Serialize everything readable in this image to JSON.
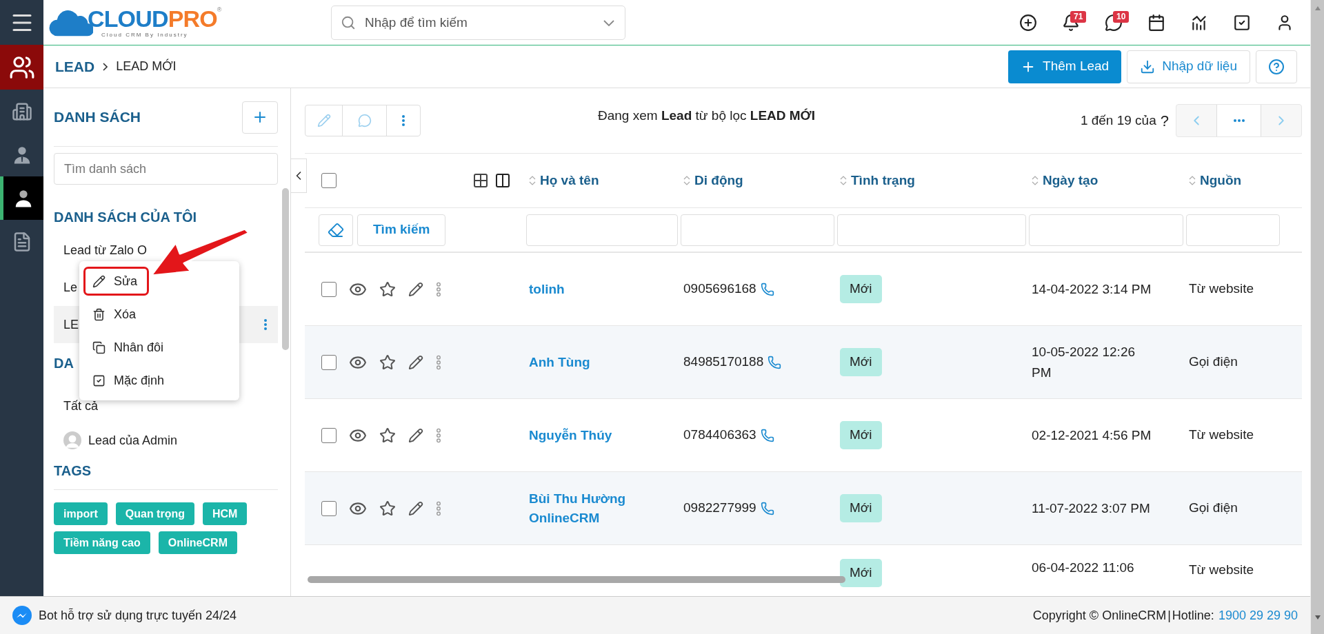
{
  "logo": {
    "text_1": "CLOUD",
    "text_2": "PRO",
    "mark": "®",
    "tagline": "Cloud CRM By Industry"
  },
  "search": {
    "placeholder": "Nhập để tìm kiếm"
  },
  "header_icons": [
    {
      "kind": "add"
    },
    {
      "kind": "bell",
      "badge": "71"
    },
    {
      "kind": "chat",
      "badge": "10"
    },
    {
      "kind": "calendar"
    },
    {
      "kind": "chart"
    },
    {
      "kind": "task"
    },
    {
      "kind": "user"
    }
  ],
  "rail": {
    "module_button": {
      "kind": "users"
    },
    "items": [
      {
        "kind": "building",
        "selected": false
      },
      {
        "kind": "contact",
        "selected": false
      },
      {
        "kind": "person",
        "selected": true
      },
      {
        "kind": "document",
        "selected": false
      }
    ]
  },
  "breadcrumb": {
    "module": "LEAD",
    "current": "LEAD MỚI"
  },
  "actions": {
    "primary": "Thêm Lead",
    "import": "Nhập dữ liệu"
  },
  "sidebar": {
    "title": "DANH SÁCH",
    "search_placeholder": "Tìm danh sách",
    "my_lists_title": "DANH SÁCH CỦA TÔI",
    "my_lists": [
      {
        "label": "Lead từ Zalo O",
        "selected": false
      },
      {
        "label": "Le",
        "selected": false
      },
      {
        "label": "LE",
        "selected": true
      }
    ],
    "shared_title": "DA",
    "shared_lists": [
      {
        "label": "Tất cả",
        "kind": "plain"
      },
      {
        "label": "Lead của Admin",
        "kind": "avatar"
      }
    ],
    "tags_title": "TAGS",
    "tags": [
      "import",
      "Quan trọng",
      "HCM",
      "Tiềm năng cao",
      "OnlineCRM"
    ]
  },
  "context_menu": {
    "items": [
      {
        "kind": "edit",
        "label": "Sửa",
        "highlighted": true
      },
      {
        "kind": "delete",
        "label": "Xóa",
        "highlighted": false
      },
      {
        "kind": "duplicate",
        "label": "Nhân đôi",
        "highlighted": false
      },
      {
        "kind": "default",
        "label": "Mặc định",
        "highlighted": false
      }
    ]
  },
  "view_title": {
    "prefix": "Đang xem",
    "module": "Lead",
    "middle": "từ bộ lọc",
    "filter": "LEAD MỚI"
  },
  "pagination": {
    "text": "1 đến 19 của",
    "total": "?"
  },
  "table": {
    "select_all_checked": false,
    "columns": [
      "Họ và tên",
      "Di động",
      "Tình trạng",
      "Ngày tạo",
      "Nguồn"
    ],
    "search_button": "Tìm kiếm",
    "rows": [
      {
        "checked": false,
        "name": "tolinh",
        "phone": "0905696168",
        "status": "Mới",
        "created": "14-04-2022 3:14 PM",
        "source": "Từ website"
      },
      {
        "checked": false,
        "name": "Anh Tùng",
        "phone": "84985170188",
        "status": "Mới",
        "created": "10-05-2022 12:26 PM",
        "source": "Gọi điện"
      },
      {
        "checked": false,
        "name": "Nguyễn Thúy",
        "phone": "0784406363",
        "status": "Mới",
        "created": "02-12-2021 4:56 PM",
        "source": "Từ website"
      },
      {
        "checked": false,
        "name": "Bùi Thu Hường OnlineCRM",
        "phone": "0982277999",
        "status": "Mới",
        "created": "11-07-2022 3:07 PM",
        "source": "Gọi điện"
      },
      {
        "status": "Mới",
        "created": "06-04-2022 11:06",
        "source": "Từ website"
      }
    ]
  },
  "footer": {
    "bot": "Bot hỗ trợ sử dụng trực tuyến 24/24",
    "copyright": "Copyright © OnlineCRM",
    "separator": "|",
    "hotline_label": "Hotline:",
    "hotline": "1900 29 29 90"
  }
}
